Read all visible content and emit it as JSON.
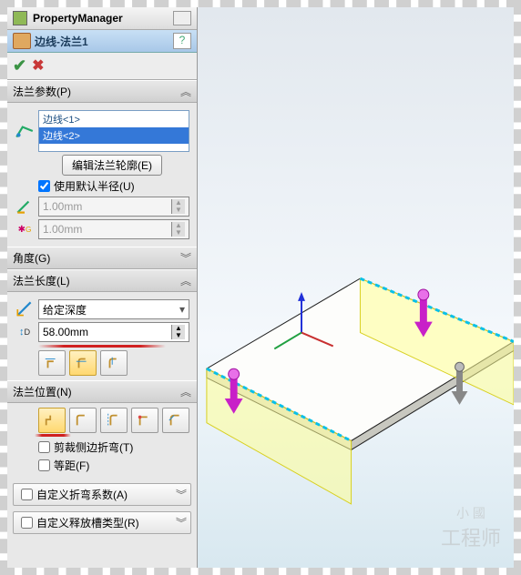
{
  "header": {
    "title": "PropertyManager"
  },
  "feature": {
    "name": "边线-法兰1",
    "help": "?"
  },
  "confirm": {
    "ok": "✔",
    "cancel": "✖"
  },
  "sections": {
    "params": {
      "title": "法兰参数(P)",
      "edges": [
        "边线<1>",
        "边线<2>"
      ],
      "selected_idx": 1,
      "edit_profile_btn": "编辑法兰轮廓(E)",
      "use_default_radius": "使用默认半径(U)",
      "radius": "1.00mm",
      "gap": "1.00mm"
    },
    "angle": {
      "title": "角度(G)"
    },
    "length": {
      "title": "法兰长度(L)",
      "end_condition": "给定深度",
      "distance": "58.00mm"
    },
    "position": {
      "title": "法兰位置(N)",
      "trim_side_bends": "剪裁侧边折弯(T)",
      "equal_offset": "等距(F)"
    },
    "bend_allowance": {
      "title": "自定义折弯系数(A)"
    },
    "relief": {
      "title": "自定义释放槽类型(R)"
    }
  },
  "watermark": {
    "line1": "小 國",
    "line2": "工程师"
  }
}
